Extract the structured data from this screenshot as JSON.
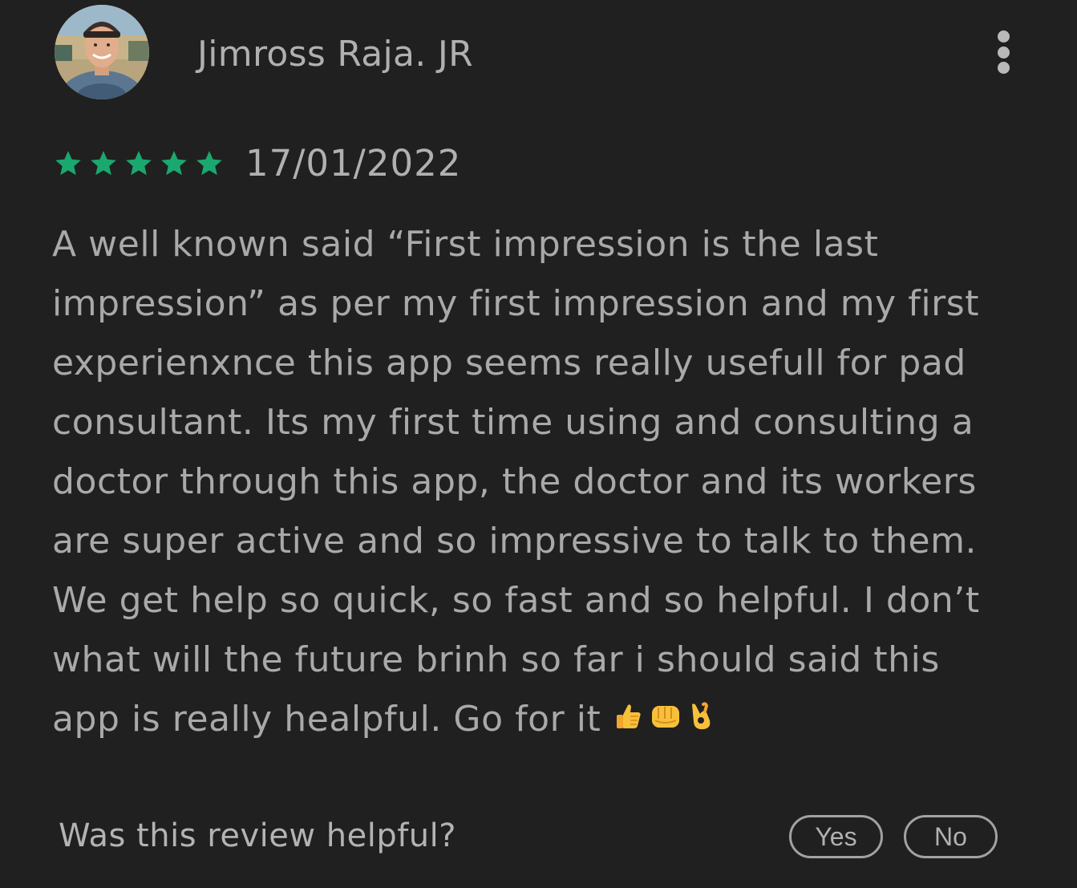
{
  "review": {
    "reviewer_name": "Jimross Raja. JR",
    "rating": 5,
    "rating_max": 5,
    "date": "17/01/2022",
    "star_color": "#1aa86f",
    "body_lines": [
      "A well known said “First impression is the last",
      "impression” as per my first impression and my first",
      "experienxnce this app seems really usefull for pad",
      "consultant. Its my first time using and consulting a",
      "doctor through this app, the doctor and its workers",
      "are super active and so impressive to talk to them.",
      "We get help so quick, so fast and so helpful. I don’t",
      "what will the future brinh so far i should said this",
      "app is really healpful. Go for it"
    ],
    "emojis": [
      "thumbs-up",
      "fist",
      "ok-hand"
    ]
  },
  "icons": {
    "menu": "more-vertical-icon",
    "star": "star-icon",
    "avatar": "user-photo"
  },
  "footer": {
    "question": "Was this review helpful?",
    "yes_label": "Yes",
    "no_label": "No"
  }
}
